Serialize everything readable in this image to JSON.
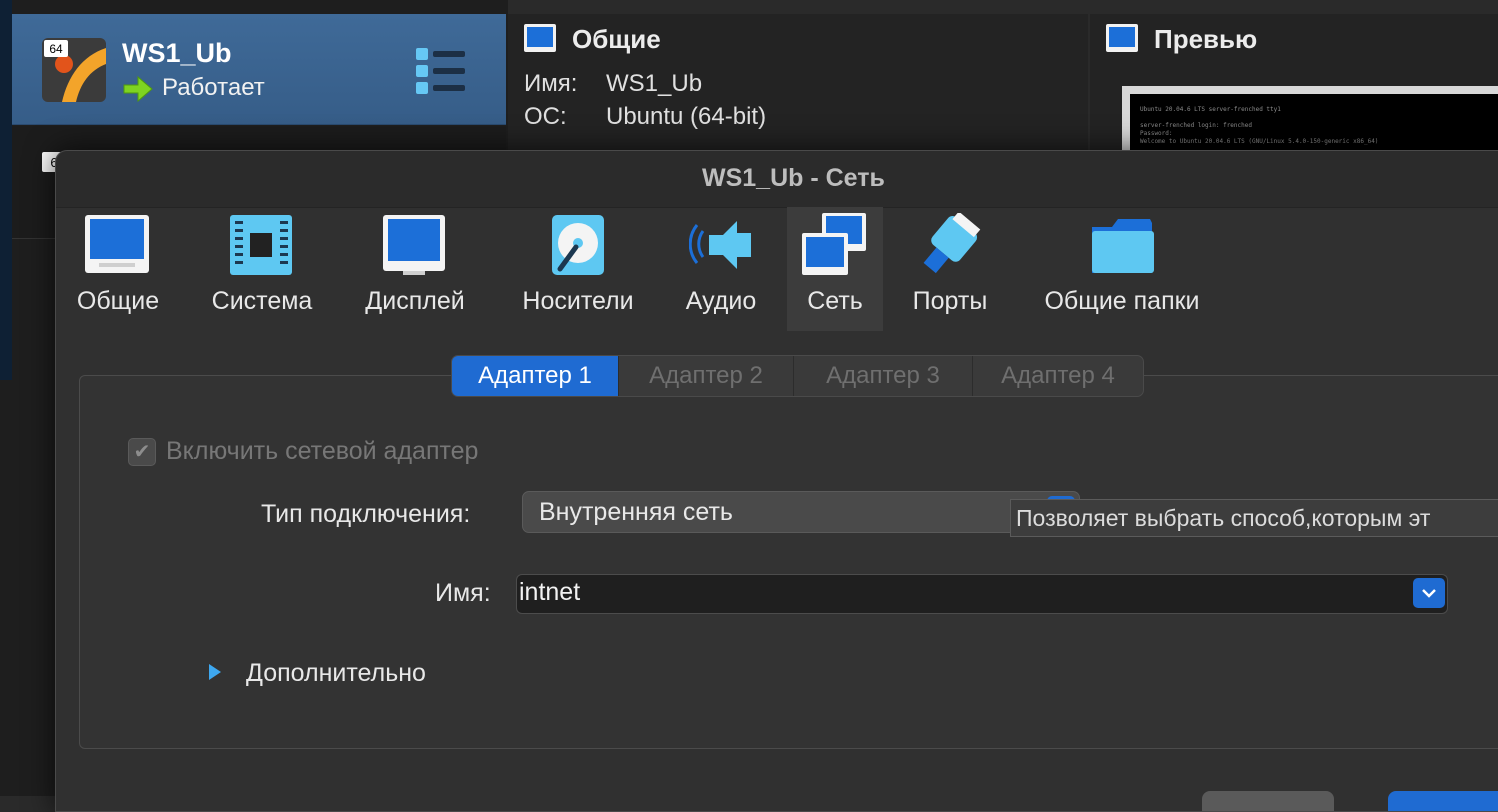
{
  "main": {
    "vm_list": [
      {
        "name": "WS1_Ub",
        "state": "Работает",
        "badge": "64"
      },
      {
        "name": "",
        "state": "",
        "badge": "6"
      }
    ],
    "general": {
      "title": "Общие",
      "rows": [
        {
          "key": "Имя:",
          "value": "WS1_Ub"
        },
        {
          "key": "ОС:",
          "value": "Ubuntu (64-bit)"
        }
      ]
    },
    "preview": {
      "title": "Превью",
      "screen_lines": [
        "Ubuntu 20.04.6 LTS server-frenched tty1",
        "server-frenched login: frenched",
        "Password:",
        "Welcome to Ubuntu 20.04.6 LTS (GNU/Linux 5.4.0-150-generic x86_64)"
      ]
    }
  },
  "dialog": {
    "title": "WS1_Ub - Сеть",
    "toolbar": [
      {
        "id": "general",
        "label": "Общие",
        "icon": "general-icon"
      },
      {
        "id": "system",
        "label": "Система",
        "icon": "chip-icon"
      },
      {
        "id": "display",
        "label": "Дисплей",
        "icon": "monitor-icon"
      },
      {
        "id": "storage",
        "label": "Носители",
        "icon": "disk-icon"
      },
      {
        "id": "audio",
        "label": "Аудио",
        "icon": "speaker-icon"
      },
      {
        "id": "network",
        "label": "Сеть",
        "icon": "network-icon",
        "selected": true
      },
      {
        "id": "ports",
        "label": "Порты",
        "icon": "port-icon"
      },
      {
        "id": "shared",
        "label": "Общие папки",
        "icon": "folder-icon"
      }
    ],
    "tabs": [
      {
        "label": "Адаптер 1",
        "active": true
      },
      {
        "label": "Адаптер 2",
        "active": false
      },
      {
        "label": "Адаптер 3",
        "active": false
      },
      {
        "label": "Адаптер 4",
        "active": false
      }
    ],
    "enable_adapter": {
      "label": "Включить сетевой адаптер",
      "checked": true,
      "enabled": false
    },
    "attached_to": {
      "label": "Тип подключения:",
      "value": "Внутренняя сеть"
    },
    "tooltip": "Позволяет выбрать способ,которым эт",
    "name": {
      "label": "Имя:",
      "value": "intnet"
    },
    "advanced": {
      "label": "Дополнительно"
    }
  },
  "colors": {
    "accent": "#1f6bd2",
    "icon_blue": "#1c6fd8",
    "icon_cyan": "#5ec8f2"
  }
}
